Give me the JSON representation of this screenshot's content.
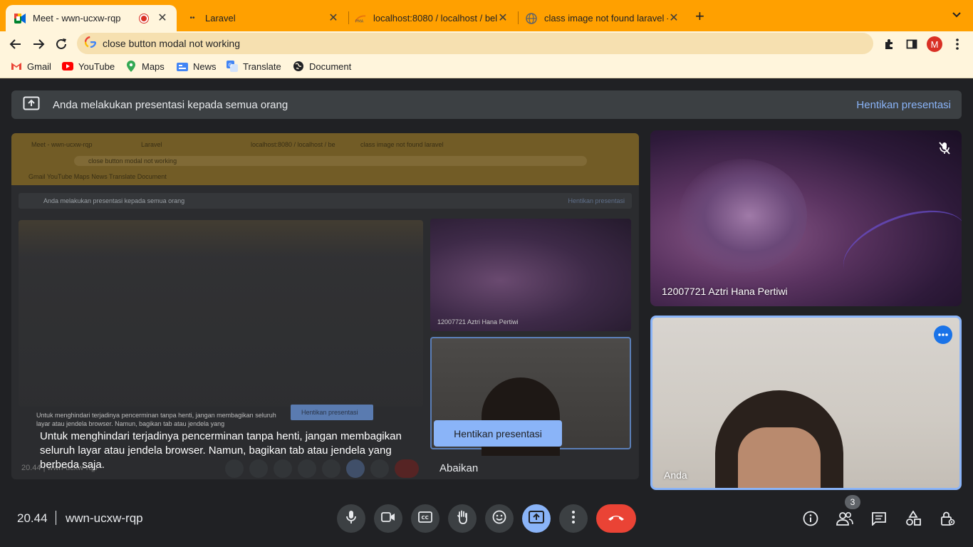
{
  "browser": {
    "tabs": [
      {
        "title": "Meet - wwn-ucxw-rqp",
        "active": true
      },
      {
        "title": "Laravel"
      },
      {
        "title": "localhost:8080 / localhost / bel"
      },
      {
        "title": "class image not found laravel -"
      }
    ],
    "address": "close button modal not working",
    "avatar_letter": "M",
    "bookmarks": [
      "Gmail",
      "YouTube",
      "Maps",
      "News",
      "Translate",
      "Document"
    ]
  },
  "banner": {
    "message": "Anda melakukan presentasi kepada semua orang",
    "stop_label": "Hentikan presentasi"
  },
  "share": {
    "warning": "Untuk menghindari terjadinya pencerminan tanpa henti, jangan membagikan seluruh layar atau jendela browser. Namun, bagikan tab atau jendela yang berbeda saja.",
    "stop_label": "Hentikan presentasi",
    "ignore_label": "Abaikan",
    "mirror": {
      "tab1": "Meet - wwn-ucxw-rqp",
      "tab2": "Laravel",
      "tab3": "localhost:8080 / localhost / be",
      "tab4": "class image not found laravel",
      "address": "close button modal not working",
      "bookmarks": "Gmail   YouTube   Maps   News   Translate   Document",
      "banner": "Anda melakukan presentasi kepada semua orang",
      "banner_stop": "Hentikan presentasi",
      "participant": "12007721 Aztri Hana Pertiwi",
      "warning": "Untuk menghindari terjadinya pencerminan tanpa henti, jangan membagikan seluruh layar atau jendela browser. Namun, bagikan tab atau jendela yang",
      "stop": "Hentikan presentasi",
      "clock": "20.44  |  wwn-ucxw-rqp"
    }
  },
  "participants": [
    {
      "name": "12007721 Aztri Hana Pertiwi",
      "muted": true
    },
    {
      "name": "Anda",
      "speaking": true
    }
  ],
  "bottom": {
    "time": "20.44",
    "meeting_code": "wwn-ucxw-rqp",
    "participant_count": "3"
  },
  "colors": {
    "tab_bar": "#ffa000",
    "toolbar": "#fff5dc",
    "meet_bg": "#202124",
    "accent": "#8ab4f8",
    "end_call": "#ea4335"
  }
}
